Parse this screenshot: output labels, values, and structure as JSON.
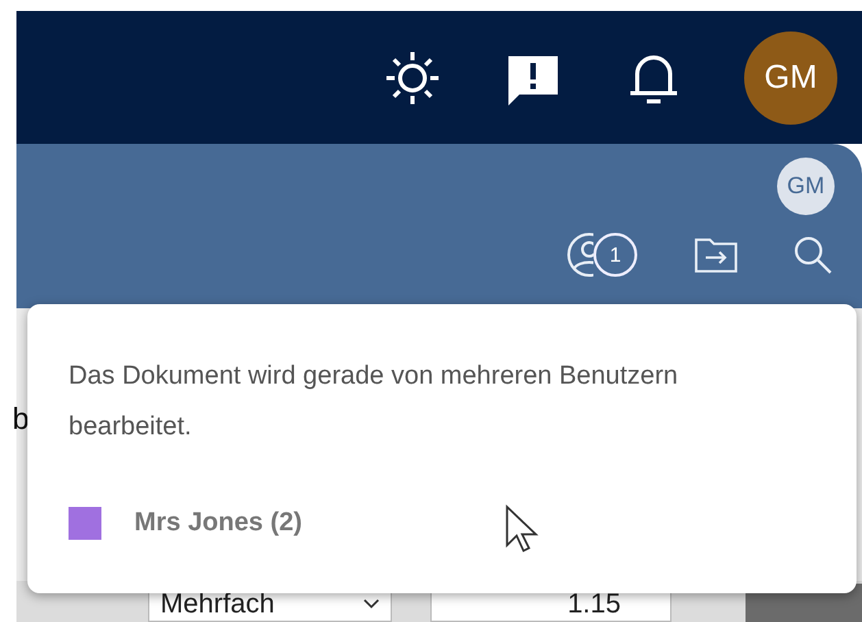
{
  "header": {
    "avatar": "GM"
  },
  "panel": {
    "avatar": "GM",
    "editors_badge": "1"
  },
  "document": {
    "fragment": "b",
    "toolbar": {
      "spacing_mode": "Mehrfach",
      "spacing_value": "1.15"
    }
  },
  "popover": {
    "message": "Das Dokument wird gerade von mehreren Benutzern bearbeitet.",
    "users": [
      {
        "name": "Mrs Jones (2)",
        "color": "#a070e0"
      }
    ]
  }
}
